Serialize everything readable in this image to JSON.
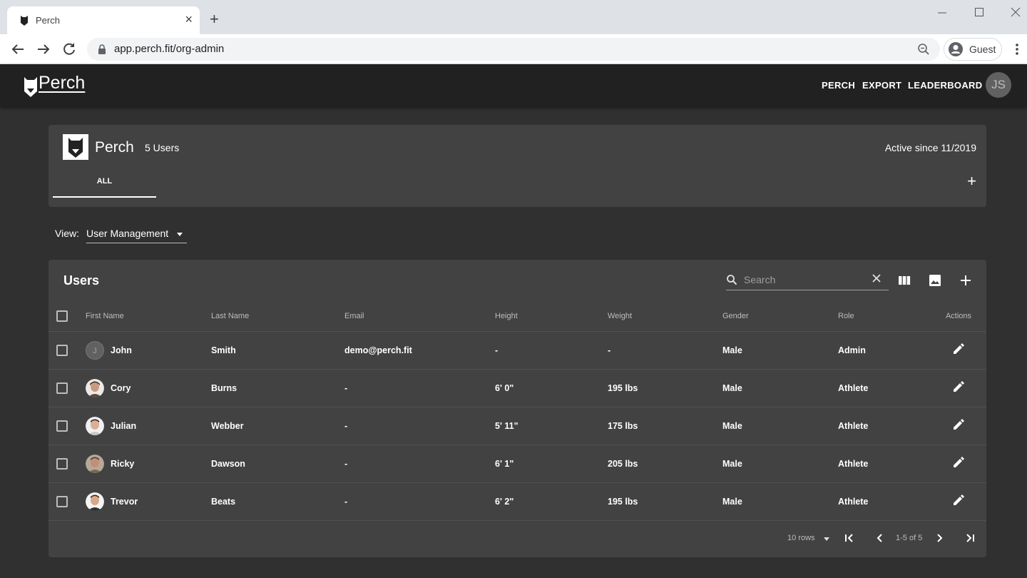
{
  "browser": {
    "tab_title": "Perch",
    "url": "app.perch.fit/org-admin",
    "profile_label": "Guest"
  },
  "app": {
    "logo_text": "Perch",
    "nav": [
      "PERCH",
      "EXPORT",
      "LEADERBOARD"
    ],
    "user_initials": "JS"
  },
  "org": {
    "name": "Perch",
    "user_count": "5 Users",
    "active_since": "Active since 11/2019",
    "tab_all": "ALL"
  },
  "view": {
    "label": "View:",
    "value": "User Management"
  },
  "users_table": {
    "title": "Users",
    "search_placeholder": "Search",
    "columns": [
      "First Name",
      "Last Name",
      "Email",
      "Height",
      "Weight",
      "Gender",
      "Role",
      "Actions"
    ],
    "rows": [
      {
        "first": "John",
        "last": "Smith",
        "email": "demo@perch.fit",
        "height": "-",
        "weight": "-",
        "gender": "Male",
        "role": "Admin",
        "avatar_letter": "J"
      },
      {
        "first": "Cory",
        "last": "Burns",
        "email": "-",
        "height": "6' 0\"",
        "weight": "195 lbs",
        "gender": "Male",
        "role": "Athlete"
      },
      {
        "first": "Julian",
        "last": "Webber",
        "email": "-",
        "height": "5' 11\"",
        "weight": "175 lbs",
        "gender": "Male",
        "role": "Athlete"
      },
      {
        "first": "Ricky",
        "last": "Dawson",
        "email": "-",
        "height": "6' 1\"",
        "weight": "205 lbs",
        "gender": "Male",
        "role": "Athlete"
      },
      {
        "first": "Trevor",
        "last": "Beats",
        "email": "-",
        "height": "6' 2\"",
        "weight": "195 lbs",
        "gender": "Male",
        "role": "Athlete"
      }
    ],
    "rows_per_page": "10 rows",
    "page_info": "1-5 of 5"
  },
  "colors": {
    "page_bg": "#303030",
    "card_bg": "#424242",
    "appbar_bg": "#212121"
  }
}
